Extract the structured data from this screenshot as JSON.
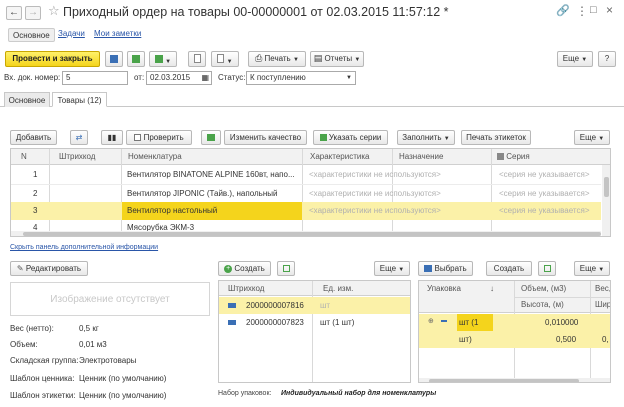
{
  "window": {
    "title": "Приходный ордер на товары 00-00000001 от 02.03.2015 11:57:12 *"
  },
  "nav_tabs": [
    {
      "label": "Основное"
    },
    {
      "label": "Задачи"
    },
    {
      "label": "Мои заметки"
    }
  ],
  "toolbar": {
    "post_close": "Провести и закрыть",
    "print": "Печать",
    "reports": "Отчеты",
    "more": "Еще",
    "help": "?"
  },
  "form": {
    "doc_num_label": "Вх. док. номер:",
    "doc_num_value": "5",
    "date_label": "от:",
    "date_value": "02.03.2015",
    "status_label": "Статус:",
    "status_value": "К поступлению"
  },
  "inner_tabs": [
    {
      "label": "Основное"
    },
    {
      "label": "Товары (12)"
    }
  ],
  "goods_toolbar": {
    "add": "Добавить",
    "check": "Проверить",
    "change_quality": "Изменить качество",
    "specify_series": "Указать серии",
    "fill": "Заполнить",
    "print_labels": "Печать этикеток",
    "more": "Еще"
  },
  "table": {
    "columns": {
      "n": "N",
      "barcode": "Штрихкод",
      "nomenclature": "Номенклатура",
      "characteristic": "Характеристика",
      "purpose": "Назначение",
      "series": "Серия"
    },
    "rows": [
      {
        "n": "1",
        "name": "Вентилятор BINATONE ALPINE 160вт, напо...",
        "char": "<характеристики не используются>",
        "series": "<серия не указывается>"
      },
      {
        "n": "2",
        "name": "Вентилятор JIPONIC (Тайв.), напольный",
        "char": "<характеристики не используются>",
        "series": "<серия не указывается>"
      },
      {
        "n": "3",
        "name": "Вентилятор настольный",
        "char": "<характеристики не используются>",
        "series": "<серия не указывается>"
      },
      {
        "n": "4",
        "name": "Мясорубка ЭКМ-3",
        "char": "",
        "series": ""
      }
    ]
  },
  "hide_panel_link": "Скрыть панель дополнительной информации",
  "left_panel": {
    "edit": "Редактировать",
    "no_image": "Изображение отсутствует",
    "weight_label": "Вес (нетто):",
    "weight_value": "0,5 кг",
    "volume_label": "Объем:",
    "volume_value": "0,01 м3",
    "warehouse_group_label": "Складская группа:",
    "warehouse_group_value": "Электротовары",
    "price_tag_label": "Шаблон ценника:",
    "price_tag_value": "Ценник (по умолчанию)",
    "label_template_label": "Шаблон этикетки:",
    "label_template_value": "Ценник (по умолчанию)"
  },
  "middle_panel": {
    "create": "Создать",
    "more": "Еще",
    "col_barcode": "Штрихкод",
    "col_unit": "Ед. изм.",
    "rows": [
      {
        "barcode": "2000000007816",
        "unit": "шт"
      },
      {
        "barcode": "2000000007823",
        "unit": "шт (1 шт)"
      }
    ],
    "pack_set_label": "Набор упаковок:",
    "pack_set_value": "Индивидуальный набор для номенклатуры"
  },
  "right_panel": {
    "select": "Выбрать",
    "create": "Создать",
    "more": "Еще",
    "col_pack": "Упаковка",
    "col_volume": "Объем, (м3)",
    "col_weight": "Вес, (",
    "col_height": "Высота, (м)",
    "col_width": "Ширина, (",
    "row_pack": "шт (1 шт)",
    "row_volume": "0,010000",
    "row_height": "0,500",
    "row_width": "0,"
  },
  "colors": {
    "accent_yellow": "#f6dc2e",
    "row_highlight": "#fbf1a8",
    "selected_cell": "#f4d41c",
    "link_blue": "#2a56a8"
  }
}
